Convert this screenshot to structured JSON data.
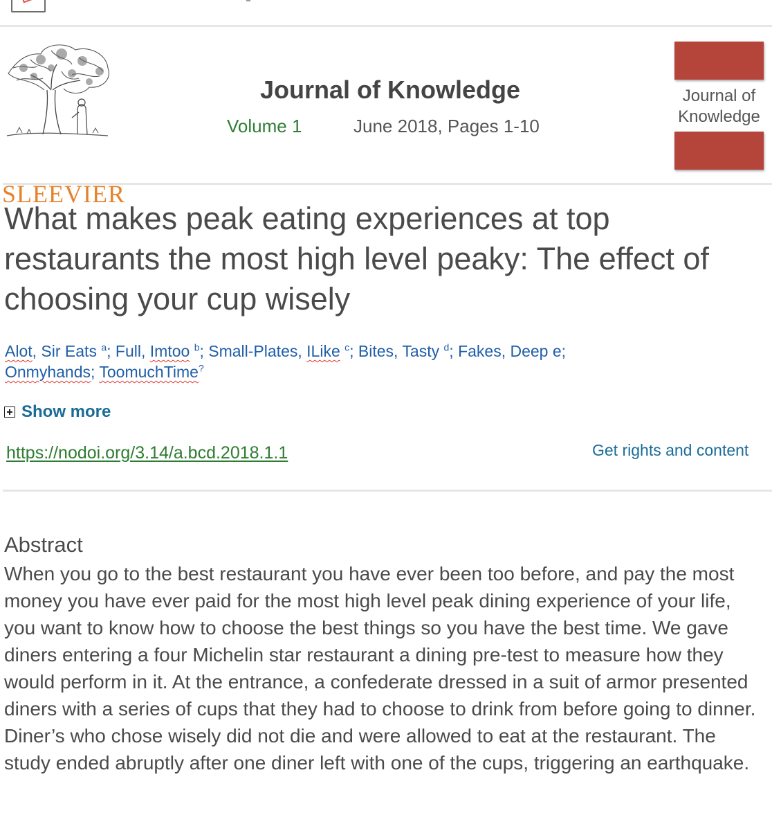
{
  "publisher": {
    "name": "SLEEVIER",
    "logo_icon": "tree-engraving-icon"
  },
  "journal": {
    "title": "Journal of Knowledge",
    "volume": "Volume 1",
    "issue_info": "June 2018, Pages 1-10",
    "cover_title": "Journal of Knowledge",
    "cover_color": "#b5453a"
  },
  "article": {
    "title": "What makes peak eating experiences at top restaurants the most high level peaky: The effect of choosing your cup wisely",
    "authors": [
      {
        "name": "Alot",
        "rest": ", Sir Eats",
        "sup": "a",
        "sep": ";  ",
        "flag": true
      },
      {
        "name": "Full",
        "rest": "",
        "sep": ", ",
        "flag": false
      },
      {
        "name": "Imtoo",
        "rest": "",
        "sup": "b",
        "sep": "; ",
        "flag": true
      },
      {
        "name": "Small-Plates",
        "rest": ", ",
        "sep": "",
        "flag": false
      },
      {
        "name": "ILike",
        "rest": "",
        "sup": "c",
        "sep": "; ",
        "flag": true
      },
      {
        "name": "Bites, Tasty",
        "rest": "",
        "sup": "d",
        "sep": ";  ",
        "flag": false
      },
      {
        "name": "Fakes, Deep e;",
        "rest": "",
        "sep": "",
        "flag": false
      },
      {
        "name": "Onmyhands",
        "rest": "",
        "sep": "; ",
        "flag": true
      },
      {
        "name": "ToomuchTime",
        "rest": "",
        "sup": "?",
        "sep": "",
        "flag": true
      }
    ],
    "show_more_label": "Show more",
    "doi": "https://nodoi.org/3.14/a.bcd.2018.1.1",
    "rights_label": "Get rights and content"
  },
  "abstract": {
    "heading": "Abstract",
    "body": "When you go to the best restaurant you have ever been too before, and pay the most money you have ever paid for the most high level peak dining experience of your life, you want to know how to choose the best things so you have the best time. We gave diners entering a four Michelin star restaurant a dining pre-test to measure how they would perform in it. At the entrance, a confederate dressed in a suit of armor presented diners with a series of cups that they had to choose to drink from before going to dinner. Diner’s who chose wisely did not die and were allowed to eat at the restaurant. The study ended abruptly after one diner left with one of the cups, triggering an earthquake."
  }
}
